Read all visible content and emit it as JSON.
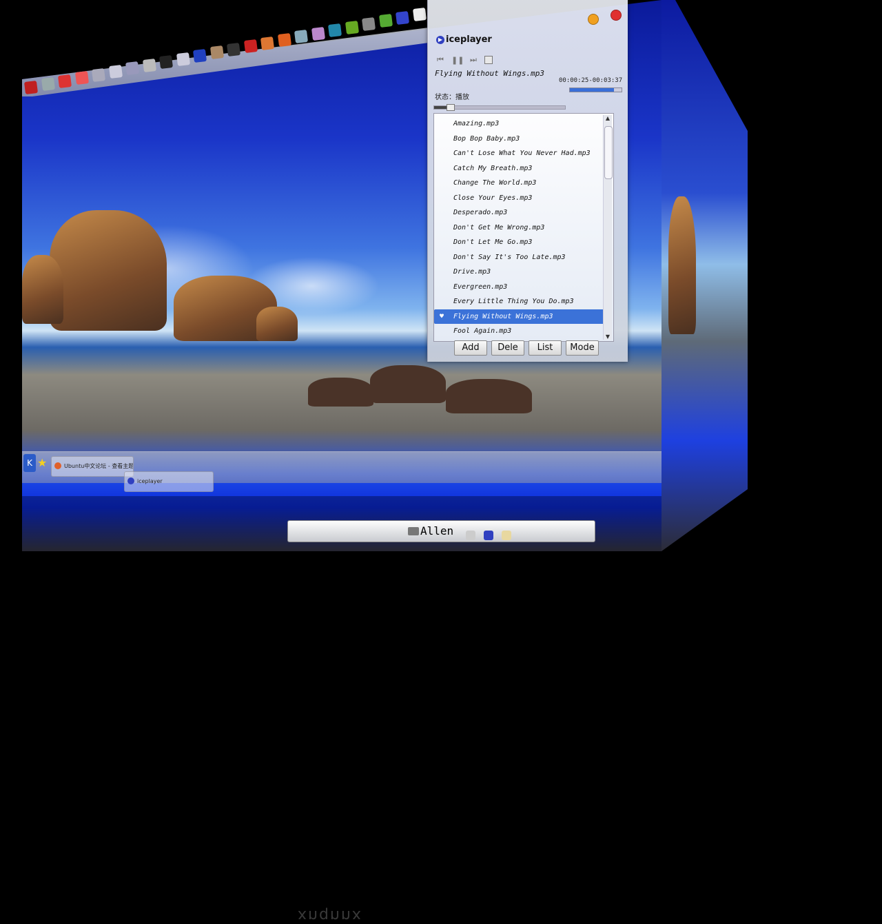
{
  "player": {
    "app_name": "iceplayer",
    "now_playing": "Flying Without Wings.mp3",
    "time": "00:00:25-00:03:37",
    "status": "状态：播放",
    "progress_fraction": 0.12,
    "volume_fraction": 0.85,
    "controls": {
      "prev": "⏮",
      "pause": "❚❚",
      "next": "⏭"
    },
    "playlist": [
      "Amazing.mp3",
      "Bop Bop Baby.mp3",
      "Can't Lose What You Never Had.mp3",
      "Catch My Breath.mp3",
      "Change The World.mp3",
      "Close Your Eyes.mp3",
      "Desperado.mp3",
      "Don't Get Me Wrong.mp3",
      "Don't Let Me Go.mp3",
      "Don't Say It's Too Late.mp3",
      "Drive.mp3",
      "Evergreen.mp3",
      "Every Little Thing You Do.mp3",
      "Flying Without Wings.mp3",
      "Fool Again.mp3"
    ],
    "active_index": 13,
    "buttons": {
      "add": "Add",
      "delete": "Dele",
      "list": "List",
      "mode": "Mode"
    }
  },
  "taskbar": {
    "tasks": [
      {
        "label": "Ubuntu中文论坛 - 查看主题",
        "color": "#e0602a"
      },
      {
        "label": "iceplayer",
        "color": "#3040c0"
      }
    ],
    "watermark": "xnqnnx"
  },
  "userbar": {
    "name": "Allen"
  },
  "colors": {
    "accent": "#3b72d8",
    "close": "#e03030",
    "minimize": "#f0a020"
  },
  "launcher_icons": [
    {
      "name": "red-app-icon",
      "color": "#c02020"
    },
    {
      "name": "disk-icon",
      "color": "#9aa"
    },
    {
      "name": "chrome-icon",
      "color": "#d33"
    },
    {
      "name": "rss-icon",
      "color": "#e55"
    },
    {
      "name": "notes-icon",
      "color": "#aab"
    },
    {
      "name": "edit-icon",
      "color": "#ccd"
    },
    {
      "name": "chat-icon",
      "color": "#99b"
    },
    {
      "name": "pen-icon",
      "color": "#bbb"
    },
    {
      "name": "terminal-icon",
      "color": "#222"
    },
    {
      "name": "document-icon",
      "color": "#ccd"
    },
    {
      "name": "media-icon",
      "color": "#2040c0"
    },
    {
      "name": "gear-icon",
      "color": "#a86"
    },
    {
      "name": "monitor-icon",
      "color": "#333"
    },
    {
      "name": "magnet-icon",
      "color": "#c22"
    },
    {
      "name": "java-icon",
      "color": "#d73"
    },
    {
      "name": "firefox-icon",
      "color": "#e06020"
    },
    {
      "name": "drive-icon",
      "color": "#8ab"
    },
    {
      "name": "image-icon",
      "color": "#b8c"
    },
    {
      "name": "chart-icon",
      "color": "#28a"
    },
    {
      "name": "android-icon",
      "color": "#6a2"
    },
    {
      "name": "tools-icon",
      "color": "#888"
    },
    {
      "name": "book-icon",
      "color": "#5a3"
    },
    {
      "name": "arrow-icon",
      "color": "#34c"
    },
    {
      "name": "pencil-icon",
      "color": "#eee"
    }
  ]
}
